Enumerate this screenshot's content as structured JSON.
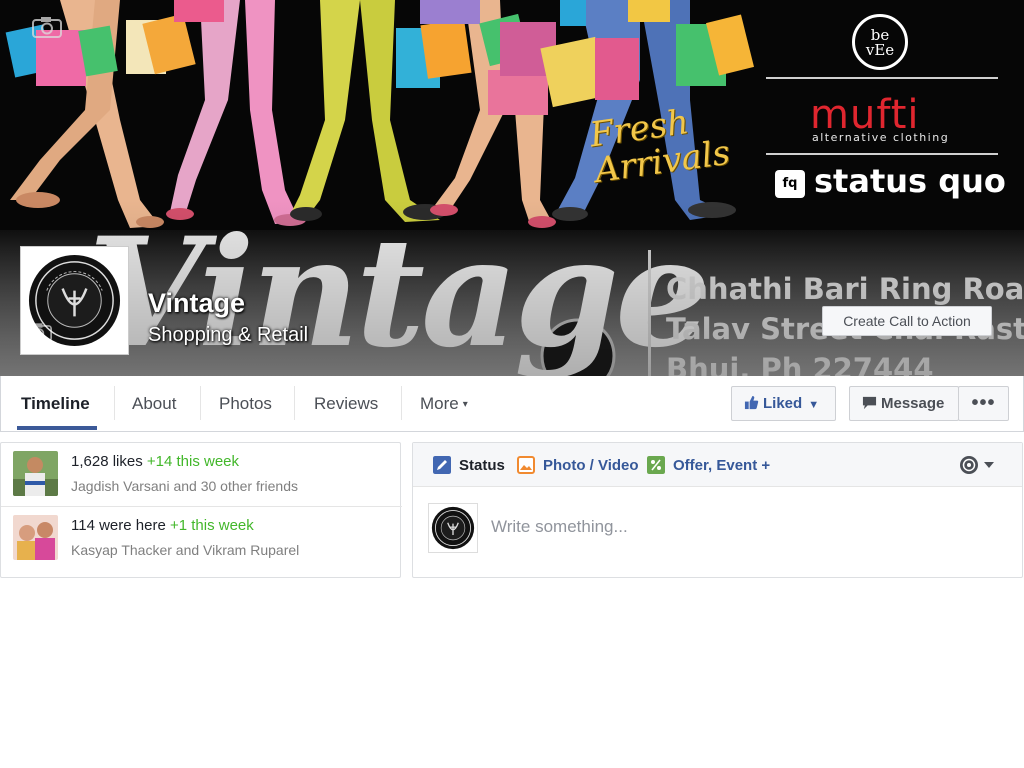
{
  "cover": {
    "fresh_line1": "Fresh",
    "fresh_line2": "Arrivals",
    "brand_beve": "be vEe",
    "brand_mufti": "mufti",
    "brand_mufti_tagline": "alternative clothing",
    "brand_sq_logo": "fq",
    "brand_status_quo": "status quo",
    "big_text": "Vintage",
    "address_line1": "Chhathi Bari Ring Road,",
    "address_line2": "Talav Street Chai Rasta,",
    "address_line3": "Bhuj. Ph 227444",
    "call_to_action": "Create Call to Action"
  },
  "page": {
    "name": "Vintage",
    "category": "Shopping & Retail"
  },
  "nav": {
    "tabs": [
      {
        "label": "Timeline"
      },
      {
        "label": "About"
      },
      {
        "label": "Photos"
      },
      {
        "label": "Reviews"
      },
      {
        "label": "More"
      }
    ],
    "more_caret": "▾",
    "liked_label": "Liked",
    "message_label": "Message",
    "overflow_label": "•••"
  },
  "stats": {
    "likes_text": "1,628 likes",
    "likes_delta": "+14 this week",
    "likes_friends": "Jagdish Varsani and 30 other friends",
    "checkins_text": "114 were here",
    "checkins_delta": "+1 this week",
    "checkins_friends": "Kasyap Thacker and Vikram Ruparel"
  },
  "composer": {
    "tabs": [
      {
        "label": "Status"
      },
      {
        "label": "Photo / Video"
      },
      {
        "label": "Offer, Event +"
      }
    ],
    "placeholder": "Write something..."
  },
  "colors": {
    "fb_blue": "#3b5998",
    "link_blue": "#365899",
    "green": "#42b72a",
    "mufti_red": "#e0262f"
  },
  "icons": [
    "camera-icon",
    "thumbs-up-icon",
    "chevron-down-icon",
    "message-icon",
    "more-dots-icon",
    "pencil-icon",
    "photo-icon",
    "offer-icon",
    "privacy-icon"
  ]
}
